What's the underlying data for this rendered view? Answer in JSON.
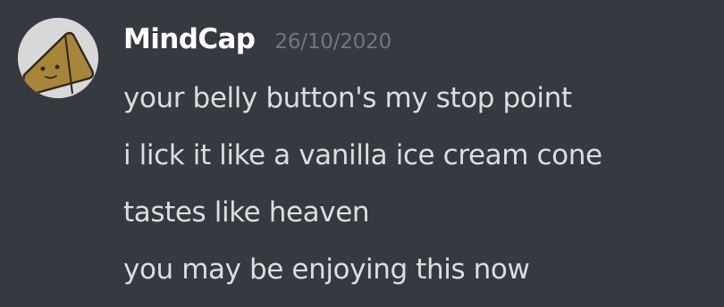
{
  "message": {
    "avatar": {
      "icon": "triangle-face-avatar-icon",
      "colors": {
        "background": "#d8d8d8",
        "shape": "#a7853b",
        "outline": "#2f2719"
      }
    },
    "author": "MindCap",
    "timestamp": "26/10/2020",
    "lines": [
      "your belly button's my stop point",
      "i lick it like a vanilla ice cream cone",
      "tastes like heaven",
      "you may be enjoying this now"
    ]
  },
  "colors": {
    "background": "#36393f",
    "username": "#ffffff",
    "timestamp": "#72767d",
    "text": "#dcddde"
  }
}
